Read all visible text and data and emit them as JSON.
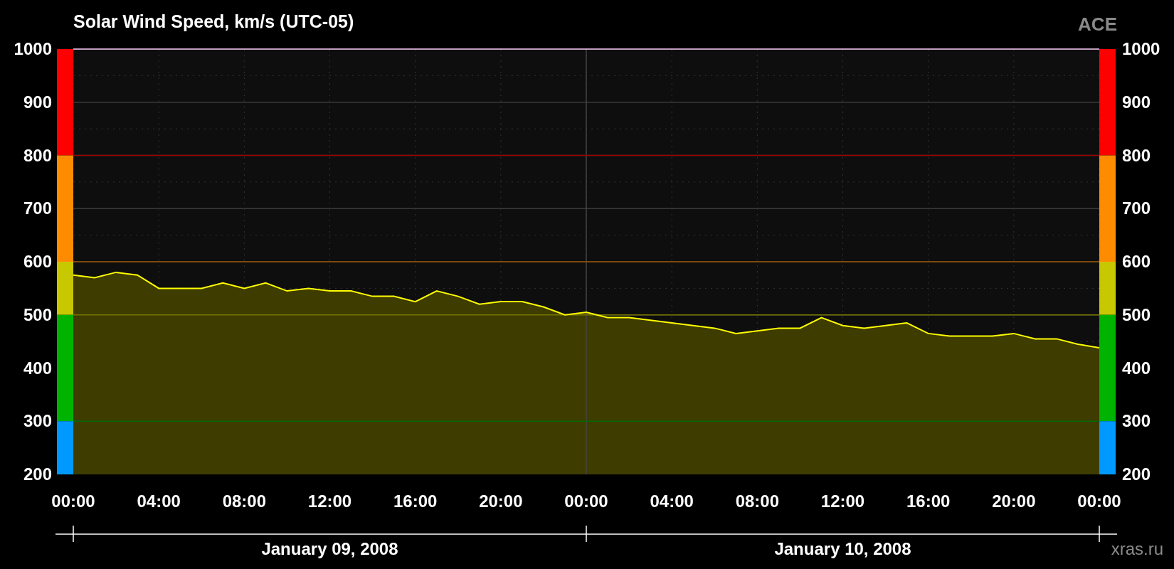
{
  "title": "Solar Wind Speed, km/s (UTC-05)",
  "instrument_label": "ACE",
  "scale_bands": [
    {
      "color": "#ff0000"
    },
    {
      "color": "#ff8c00"
    },
    {
      "color": "#c8c800"
    },
    {
      "color": "#00b300"
    },
    {
      "color": "#0099ff"
    }
  ],
  "chart_data": {
    "type": "area",
    "grid": true,
    "ref_lines": [
      {
        "axis": "x",
        "value": "2008-01-10T00:00"
      },
      {
        "axis": "y",
        "value": 800
      },
      {
        "axis": "y",
        "value": 600
      },
      {
        "axis": "y",
        "value": 500
      },
      {
        "axis": "y",
        "value": 300
      }
    ],
    "ylim": [
      200,
      1000
    ],
    "yticks": [
      200,
      300,
      400,
      500,
      600,
      700,
      800,
      900,
      1000
    ],
    "xlim": [
      "2008-01-09T00:00",
      "2008-01-11T00:00"
    ],
    "xticks": [
      {
        "value": "2008-01-09T00:00",
        "label": "00:00"
      },
      {
        "value": "2008-01-09T04:00",
        "label": "04:00"
      },
      {
        "value": "2008-01-09T08:00",
        "label": "08:00"
      },
      {
        "value": "2008-01-09T12:00",
        "label": "12:00"
      },
      {
        "value": "2008-01-09T16:00",
        "label": "16:00"
      },
      {
        "value": "2008-01-09T20:00",
        "label": "20:00"
      },
      {
        "value": "2008-01-10T00:00",
        "label": "00:00"
      },
      {
        "value": "2008-01-10T04:00",
        "label": "04:00"
      },
      {
        "value": "2008-01-10T08:00",
        "label": "08:00"
      },
      {
        "value": "2008-01-10T12:00",
        "label": "12:00"
      },
      {
        "value": "2008-01-10T16:00",
        "label": "16:00"
      },
      {
        "value": "2008-01-10T20:00",
        "label": "20:00"
      },
      {
        "value": "2008-01-11T00:00",
        "label": "00:00"
      }
    ],
    "x": [
      "2008-01-09T00:00",
      "2008-01-09T01:00",
      "2008-01-09T02:00",
      "2008-01-09T03:00",
      "2008-01-09T04:00",
      "2008-01-09T05:00",
      "2008-01-09T06:00",
      "2008-01-09T07:00",
      "2008-01-09T08:00",
      "2008-01-09T09:00",
      "2008-01-09T10:00",
      "2008-01-09T11:00",
      "2008-01-09T12:00",
      "2008-01-09T13:00",
      "2008-01-09T14:00",
      "2008-01-09T15:00",
      "2008-01-09T16:00",
      "2008-01-09T17:00",
      "2008-01-09T18:00",
      "2008-01-09T19:00",
      "2008-01-09T20:00",
      "2008-01-09T21:00",
      "2008-01-09T22:00",
      "2008-01-09T23:00",
      "2008-01-10T00:00",
      "2008-01-10T01:00",
      "2008-01-10T02:00",
      "2008-01-10T03:00",
      "2008-01-10T04:00",
      "2008-01-10T05:00",
      "2008-01-10T06:00",
      "2008-01-10T07:00",
      "2008-01-10T08:00",
      "2008-01-10T09:00",
      "2008-01-10T10:00",
      "2008-01-10T11:00",
      "2008-01-10T12:00",
      "2008-01-10T13:00",
      "2008-01-10T14:00",
      "2008-01-10T15:00",
      "2008-01-10T16:00",
      "2008-01-10T17:00",
      "2008-01-10T18:00",
      "2008-01-10T19:00",
      "2008-01-10T20:00",
      "2008-01-10T21:00",
      "2008-01-10T22:00",
      "2008-01-10T23:00",
      "2008-01-11T00:00"
    ],
    "series": [
      {
        "color": "#ffff00",
        "values": [
          575,
          570,
          580,
          575,
          550,
          550,
          550,
          560,
          550,
          560,
          545,
          550,
          545,
          545,
          535,
          535,
          525,
          545,
          535,
          520,
          525,
          525,
          515,
          500,
          505,
          495,
          495,
          490,
          485,
          480,
          475,
          465,
          470,
          475,
          475,
          495,
          480,
          475,
          480,
          485,
          465,
          460,
          460,
          460,
          465,
          455,
          455,
          445,
          438
        ]
      }
    ]
  },
  "right_axis_labels": [
    "1000",
    "900",
    "800",
    "700",
    "600",
    "500",
    "400",
    "300",
    "200"
  ],
  "dates": [
    "January 09, 2008",
    "January 10, 2008"
  ],
  "credit": "xras.ru"
}
